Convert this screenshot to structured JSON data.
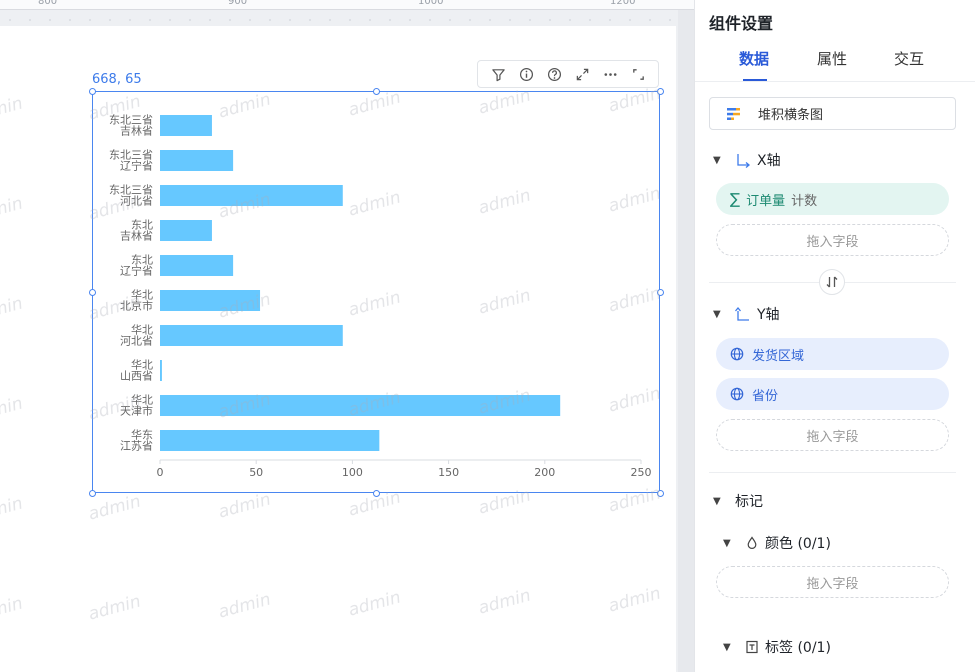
{
  "ruler": {
    "labels": [
      "800",
      "900",
      "1000",
      "1200"
    ]
  },
  "watermark": "admin",
  "component": {
    "position_label": "668, 65"
  },
  "chart_data": {
    "type": "bar",
    "orientation": "horizontal",
    "categories": [
      [
        "东北三省",
        "吉林省"
      ],
      [
        "东北三省",
        "辽宁省"
      ],
      [
        "东北三省",
        "河北省"
      ],
      [
        "东北",
        "吉林省"
      ],
      [
        "东北",
        "辽宁省"
      ],
      [
        "华北",
        "北京市"
      ],
      [
        "华北",
        "河北省"
      ],
      [
        "华北",
        "山西省"
      ],
      [
        "华北",
        "天津市"
      ],
      [
        "华东",
        "江苏省"
      ]
    ],
    "values": [
      27,
      38,
      95,
      27,
      38,
      52,
      95,
      1,
      208,
      114
    ],
    "xlim": [
      0,
      250
    ],
    "xticks": [
      "0",
      "50",
      "100",
      "150",
      "200",
      "250"
    ],
    "bar_color": "#66c8ff"
  },
  "panel": {
    "title": "组件设置",
    "tabs": [
      {
        "label": "数据",
        "active": true
      },
      {
        "label": "属性",
        "active": false
      },
      {
        "label": "交互",
        "active": false
      }
    ],
    "chart_type": "堆积横条图",
    "x_axis": {
      "label": "X轴",
      "field": {
        "name": "订单量",
        "agg": "计数"
      },
      "dropzone": "拖入字段"
    },
    "y_axis": {
      "label": "Y轴",
      "fields": [
        "发货区域",
        "省份"
      ],
      "dropzone": "拖入字段"
    },
    "marks": {
      "label": "标记",
      "color": {
        "label": "颜色 (0/1)",
        "dropzone": "拖入字段"
      },
      "tag": {
        "label": "标签 (0/1)"
      }
    }
  },
  "colors": {
    "accent": "#2a5ad8",
    "selection": "#4a86f0"
  }
}
